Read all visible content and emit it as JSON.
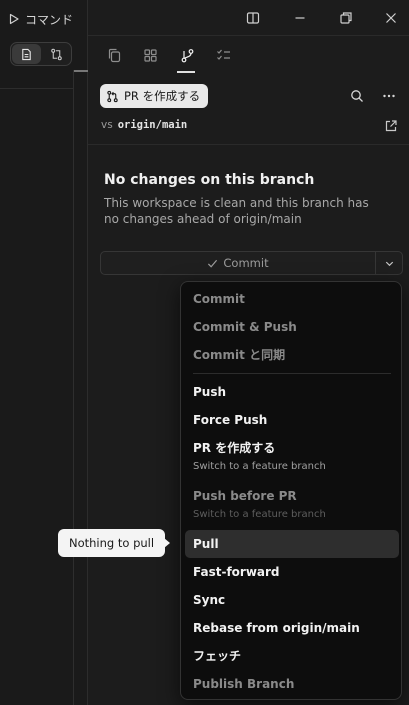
{
  "left": {
    "command_label": "コマンド"
  },
  "toolbar": {
    "pr_button_label": "PR を作成する",
    "vs_label": "vs",
    "branch": "origin/main"
  },
  "empty_state": {
    "title": "No changes on this branch",
    "description": "This workspace is clean and this branch has no changes ahead of origin/main"
  },
  "commit": {
    "label": "Commit"
  },
  "menu": {
    "items": [
      {
        "label": "Commit",
        "disabled": true
      },
      {
        "label": "Commit & Push",
        "disabled": true
      },
      {
        "label": "Commit と同期",
        "disabled": true
      },
      {
        "label": "Push",
        "disabled": false
      },
      {
        "label": "Force Push",
        "disabled": false
      },
      {
        "label": "PR を作成する",
        "sub": "Switch to a feature branch",
        "disabled": false
      },
      {
        "label": "Push before PR",
        "sub": "Switch to a feature branch",
        "disabled": true
      },
      {
        "label": "Pull",
        "disabled": false,
        "highlighted": true
      },
      {
        "label": "Fast-forward",
        "disabled": false
      },
      {
        "label": "Sync",
        "disabled": false
      },
      {
        "label": "Rebase from origin/main",
        "disabled": false
      },
      {
        "label": "フェッチ",
        "disabled": false
      },
      {
        "label": "Publish Branch",
        "disabled": true
      }
    ]
  },
  "tooltip": {
    "text": "Nothing to pull"
  },
  "colors": {
    "background": "#1c1c1c",
    "menu_background": "#0d0d0d",
    "highlight": "#2e2e2e",
    "pr_button": "#e9e9e9"
  },
  "icons": [
    "play-icon",
    "file-icon",
    "compare-icon",
    "sidebar-toggle-icon",
    "minimize-icon",
    "restore-icon",
    "close-icon",
    "copy-icon",
    "grid-icon",
    "git-branch-icon",
    "checklist-icon",
    "pull-request-icon",
    "search-icon",
    "more-icon",
    "external-link-icon",
    "check-icon",
    "chevron-down-icon"
  ]
}
